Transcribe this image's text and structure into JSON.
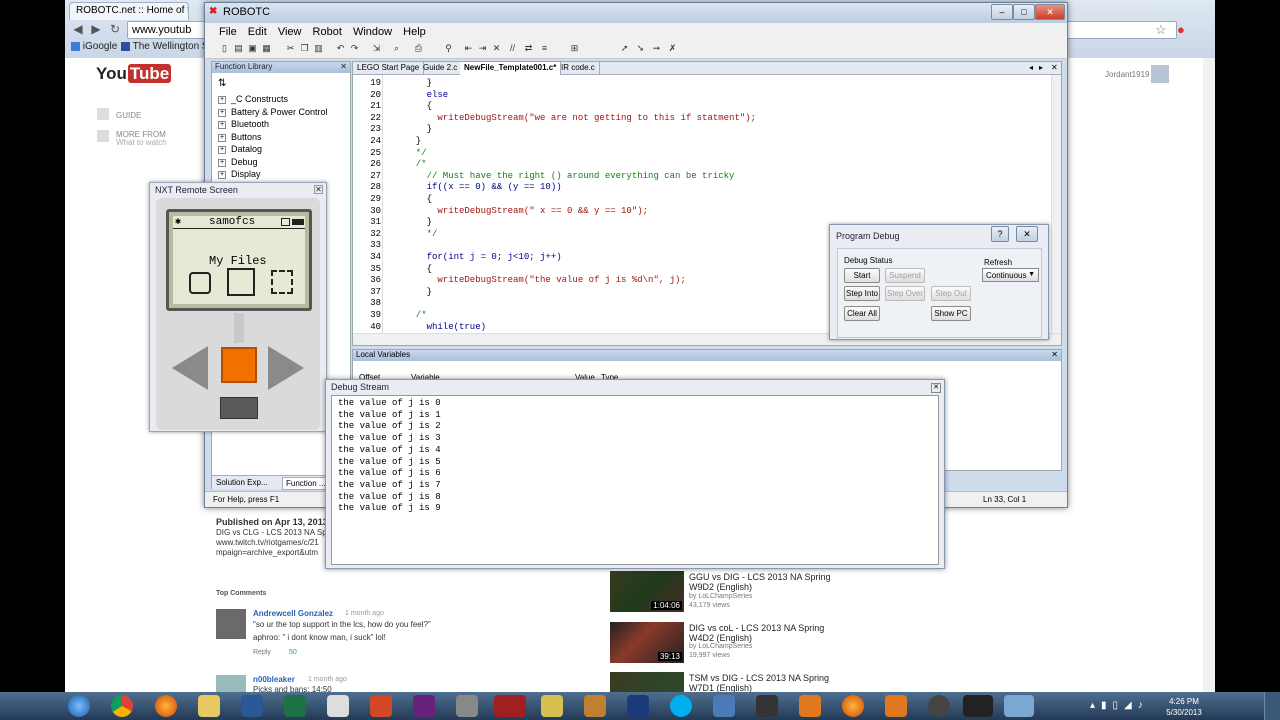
{
  "browser": {
    "tabs": [
      {
        "title": "ROBOTC.net :: Home of th"
      }
    ],
    "url": "www.youtub",
    "bookmarks": [
      "iGoogle",
      "The Wellington Sch"
    ]
  },
  "youtube": {
    "logo_you": "You",
    "logo_tube": "Tube",
    "nav": [
      "GUIDE",
      "MORE FROM",
      "What to watch"
    ],
    "user": "Jordant1919",
    "published": "Published on Apr 13, 2013",
    "desc_lines": [
      "DIG vs CLG - LCS 2013 NA Sp",
      "www.twitch.tv/riotgames/c/21",
      "mpaign=archive_export&utm"
    ],
    "top_comments_label": "Top Comments",
    "comments": [
      {
        "author": "Andrewcell Gonzalez",
        "time": "1 month ago",
        "text1": "\"so ur the top support in the lcs, how do you feel?\"",
        "text2": "aphroo: \" i dont know man, i suck\" lol!",
        "reply": "Reply",
        "likes": "50"
      },
      {
        "author": "n00bleaker",
        "time": "1 month ago",
        "text1": "Picks and bans: 14:50"
      }
    ],
    "related": [
      {
        "title": "GGU vs DIG - LCS 2013 NA Spring W9D2 (English)",
        "by": "by LoLChampSeries",
        "views": "43,179 views",
        "duration": "1:04:06"
      },
      {
        "title": "DIG vs coL - LCS 2013 NA Spring W4D2 (English)",
        "by": "by LoLChampSeries",
        "views": "19,997 views",
        "duration": "39:13"
      },
      {
        "title": "TSM vs DIG - LCS 2013 NA Spring W7D1 (English)",
        "by": "",
        "views": "",
        "duration": ""
      }
    ]
  },
  "robotc": {
    "title": "ROBOTC",
    "menu": [
      "File",
      "Edit",
      "View",
      "Robot",
      "Window",
      "Help"
    ],
    "function_library": {
      "title": "Function Library",
      "items": [
        "_C Constructs",
        "Battery & Power Control",
        "Bluetooth",
        "Buttons",
        "Datalog",
        "Debug",
        "Display"
      ],
      "bottom_tabs": [
        "Solution Exp...",
        "Function ..."
      ]
    },
    "editor_tabs": [
      "LEGO Start Page",
      "Guide 2.c",
      "NewFile_Template001.c*",
      "IR code.c"
    ],
    "code": [
      {
        "n": "19",
        "t": "    }"
      },
      {
        "n": "20",
        "t": "    else"
      },
      {
        "n": "21",
        "t": "    {"
      },
      {
        "n": "22",
        "t": "      writeDebugStream(\"we are not getting to this if statment\");"
      },
      {
        "n": "23",
        "t": "    }"
      },
      {
        "n": "24",
        "t": "  }"
      },
      {
        "n": "25",
        "t": "  */"
      },
      {
        "n": "26",
        "t": "  /*"
      },
      {
        "n": "27",
        "t": "    // Must have the right () around everything can be tricky"
      },
      {
        "n": "28",
        "t": "    if((x == 0) && (y == 10))"
      },
      {
        "n": "29",
        "t": "    {"
      },
      {
        "n": "30",
        "t": "      writeDebugStream(\" x == 0 && y == 10\");"
      },
      {
        "n": "31",
        "t": "    }"
      },
      {
        "n": "32",
        "t": "    */"
      },
      {
        "n": "33",
        "t": ""
      },
      {
        "n": "34",
        "t": "    for(int j = 0; j<10; j++)"
      },
      {
        "n": "35",
        "t": "    {"
      },
      {
        "n": "36",
        "t": "      writeDebugStream(\"the value of j is %d\\n\", j);"
      },
      {
        "n": "37",
        "t": "    }"
      },
      {
        "n": "38",
        "t": ""
      },
      {
        "n": "39",
        "t": "  /*"
      },
      {
        "n": "40",
        "t": "    while(true)"
      }
    ],
    "locals": {
      "title": "Local Variables",
      "columns": [
        "Offset",
        "Variable",
        "Value",
        "Type"
      ]
    },
    "status_left": "For Help, press F1",
    "status_right": "Ln 33, Col 1"
  },
  "nxt": {
    "title": "NXT Remote Screen",
    "lcd_name": "samofcs",
    "lcd_menu": "My Files",
    "accent": "#f07000"
  },
  "program_debug": {
    "title": "Program Debug",
    "help": "?",
    "status_label": "Debug Status",
    "refresh_label": "Refresh",
    "refresh_value": "Continuous",
    "buttons": {
      "start": "Start",
      "suspend": "Suspend",
      "step_into": "Step Into",
      "step_over": "Step Over",
      "step_out": "Step Out",
      "clear_all": "Clear All",
      "show_pc": "Show PC"
    }
  },
  "debug_stream": {
    "title": "Debug Stream",
    "lines": [
      "the value of j is 0",
      "the value of j is 1",
      "the value of j is 2",
      "the value of j is 3",
      "the value of j is 4",
      "the value of j is 5",
      "the value of j is 6",
      "the value of j is 7",
      "the value of j is 8",
      "the value of j is 9"
    ]
  },
  "taskbar": {
    "time": "4:26 PM",
    "date": "5/30/2013"
  }
}
